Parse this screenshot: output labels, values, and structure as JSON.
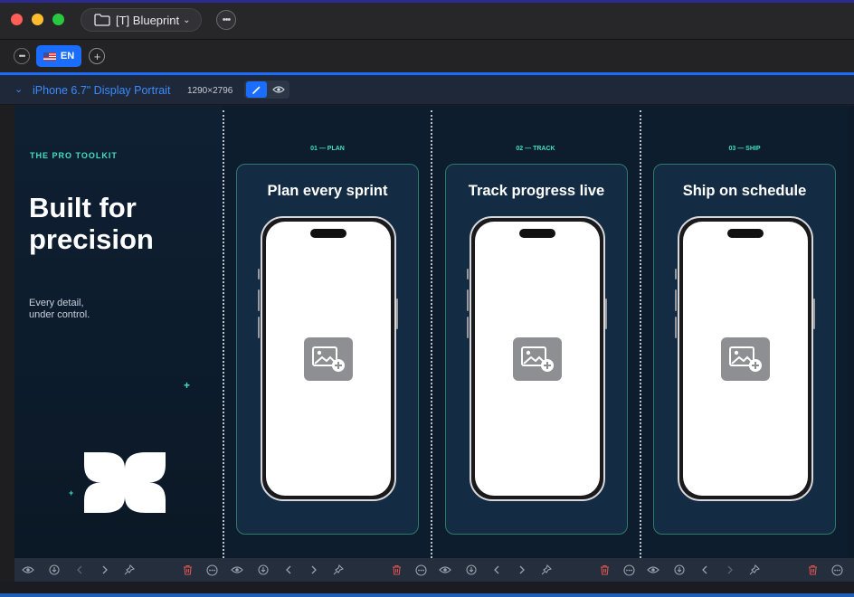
{
  "window": {
    "project_title": "[T] Blueprint",
    "colors": {
      "accent": "#1a6dff",
      "teal": "#41e0c0",
      "canvas": "#0e1d2e"
    }
  },
  "language": {
    "current": "EN"
  },
  "device": {
    "name": "iPhone 6.7\" Display Portrait",
    "size": "1290×2796"
  },
  "intro": {
    "eyebrow": "THE PRO TOOLKIT",
    "headline": "Built for precision",
    "subline": "Every detail,\nunder control."
  },
  "screens": [
    {
      "step": "01 — PLAN",
      "title": "Plan every sprint"
    },
    {
      "step": "02 — TRACK",
      "title": "Track progress live"
    },
    {
      "step": "03 — SHIP",
      "title": "Ship on schedule"
    }
  ],
  "toolbar_icons": [
    "eye-icon",
    "download-icon",
    "chevron-left-icon",
    "chevron-right-icon",
    "pin-icon",
    "trash-icon",
    "more-icon"
  ]
}
